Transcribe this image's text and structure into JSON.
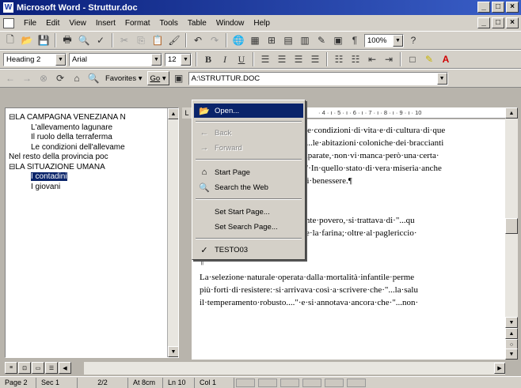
{
  "window": {
    "title": "Microsoft Word - Struttur.doc",
    "app_icon_letter": "W",
    "min_glyph": "_",
    "max_glyph": "□",
    "close_glyph": "×"
  },
  "menu": [
    "File",
    "Edit",
    "View",
    "Insert",
    "Format",
    "Tools",
    "Table",
    "Window",
    "Help"
  ],
  "standard_toolbar": {
    "zoom": "100%",
    "pilcrow": "¶"
  },
  "formatting_toolbar": {
    "style": "Heading 2",
    "font": "Arial",
    "size": "12",
    "bold": "B",
    "italic": "I",
    "underline": "U"
  },
  "web_toolbar": {
    "favorites": "Favorites",
    "go": "Go",
    "address": "A:\\STRUTTUR.DOC"
  },
  "document_map": [
    {
      "text": "⊟LA CAMPAGNA VENEZIANA N",
      "indent": 0,
      "selected": false
    },
    {
      "text": "L'allevamento lagunare",
      "indent": 1,
      "selected": false
    },
    {
      "text": "Il ruolo della terraferma",
      "indent": 1,
      "selected": false
    },
    {
      "text": "Le condizioni dell'allevame",
      "indent": 1,
      "selected": false
    },
    {
      "text": "Nel resto della provincia poc",
      "indent": 0,
      "selected": false
    },
    {
      "text": "⊟LA SITUAZIONE UMANA",
      "indent": 0,
      "selected": false
    },
    {
      "text": "I contadini",
      "indent": 1,
      "selected": true
    },
    {
      "text": "I giovani",
      "indent": 1,
      "selected": false
    }
  ],
  "ruler_text": "· 4 · ı · 5 · ı · 6 · ı · 7 · ı · 8 · ı · 9 · ı · 10",
  "document_lines": [
    "lle·condizioni·di·vita·e·di·cultura·di·que",
    "\"...le·abitazioni·coloniche·dei·braccianti",
    "riparate,·non·vi·manca·però·una·certa·",
    ".\"·In·quello·stato·di·vera·miseria·anche",
    "di·benessere.¶",
    "",
    "D'altronde·anche·era·ugualmente·povero,·si·trattava·di·\"...qu",
    "di·abete,·una·cassa·per·mettere·la·farina;·oltre·al·paglericcio·",
    "ed·alquante·coperte....\".¶",
    "¶",
    "La·selezione·naturale·operata·dalla·mortalità·infantile·perme",
    "più·forti·di·resistere:·si·arrivava·così·a·scrivere·che·\"...la·salu",
    "il·temperamento·robusto....\"·e·si·annotava·ancora·che·\"...non·"
  ],
  "go_menu": {
    "open": "Open...",
    "back": "Back",
    "forward": "Forward",
    "start_page": "Start Page",
    "search_web": "Search the Web",
    "set_start_page": "Set Start Page...",
    "set_search_page": "Set Search Page...",
    "recent": "TESTO03",
    "check": "✓"
  },
  "status": {
    "page": "Page 2",
    "sec": "Sec 1",
    "pages": "2/2",
    "at": "At 8cm",
    "ln": "Ln 10",
    "col": "Col 1"
  },
  "colors": {
    "title_start": "#0a1f7a",
    "title_end": "#3a5fc8",
    "selection": "#0a246a",
    "face": "#d4d0c8"
  }
}
